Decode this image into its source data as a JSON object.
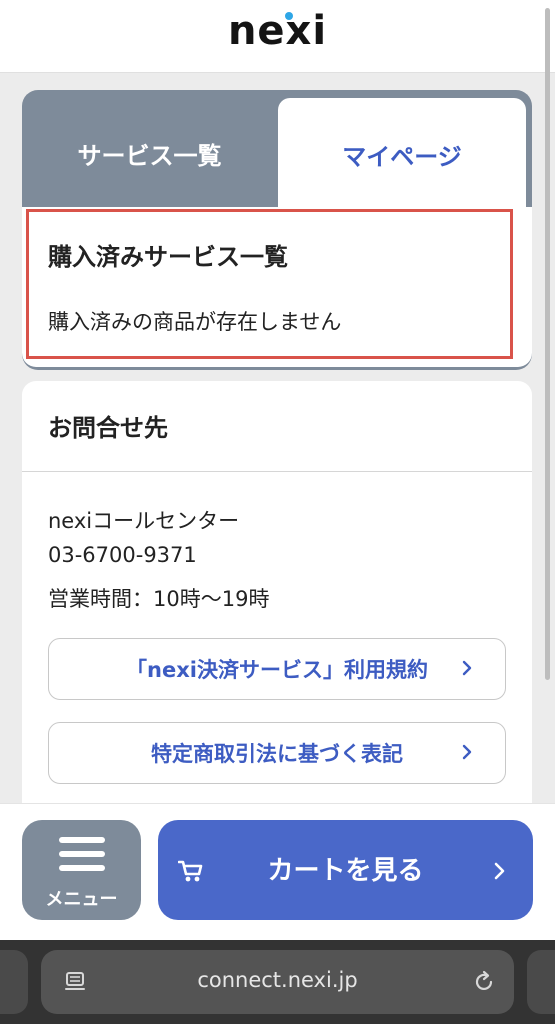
{
  "header": {
    "logo": "nexi"
  },
  "tabs": {
    "services": "サービス一覧",
    "mypage": "マイページ"
  },
  "purchased": {
    "title": "購入済みサービス一覧",
    "empty_message": "購入済みの商品が存在しません"
  },
  "contact": {
    "title": "お問合せ先",
    "center_name": "nexiコールセンター",
    "phone": "03-6700-9371",
    "hours": "営業時間：10時〜19時",
    "links": [
      {
        "label": "「nexi決済サービス」利用規約"
      },
      {
        "label": "特定商取引法に基づく表記"
      }
    ]
  },
  "bottom_nav": {
    "menu_label": "メニュー",
    "cart_label": "カートを見る"
  },
  "browser": {
    "url": "connect.nexi.jp"
  },
  "colors": {
    "accent": "#4a68c9",
    "tab_gray": "#7e8b9a",
    "highlight_border": "#d9534a",
    "logo_dot": "#2ea6e6"
  },
  "icons": {
    "menu": "hamburger-icon",
    "cart": "cart-icon",
    "chevron": "chevron-right-icon",
    "reader": "reader-mode-icon",
    "reload": "reload-icon"
  }
}
